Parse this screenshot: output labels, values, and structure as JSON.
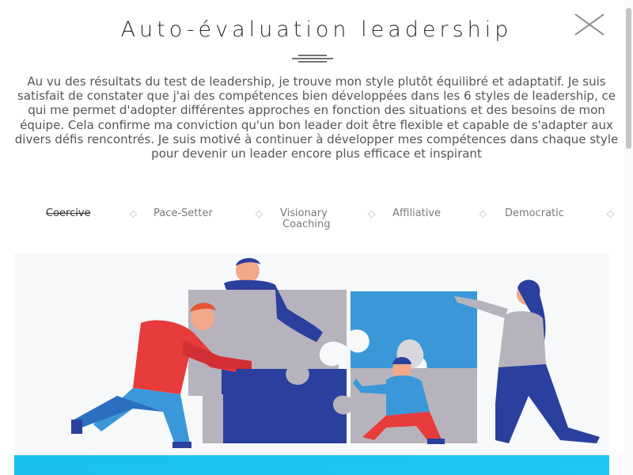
{
  "modal": {
    "title": "Auto-évaluation leadership",
    "close_icon": "close-icon",
    "intro_text": "Au vu des résultats du test de leadership, je trouve mon style plutôt équilibré et adaptatif. Je suis satisfait de constater que j'ai des compétences bien développées dans les 6 styles de leadership, ce qui me permet d'adopter différentes approches en fonction des situations et des besoins de mon équipe. Cela confirme ma conviction qu'un bon leader doit être flexible et capable de s'adapter aux divers défis rencontrés. Je suis motivé à continuer à développer mes compétences dans chaque style pour devenir un leader encore plus efficace et inspirant"
  },
  "tabs": [
    {
      "label": "Coercive",
      "active": true
    },
    {
      "label": "Pace-Setter",
      "active": false
    },
    {
      "label": "Visionary",
      "active": false
    },
    {
      "label": "Affiliative",
      "active": false
    },
    {
      "label": "Democratic",
      "active": false
    },
    {
      "label": "Coaching",
      "active": false
    }
  ],
  "illustration": {
    "name": "team-puzzle-illustration",
    "colors": {
      "red": "#e83b3b",
      "blue": "#2b3f9e",
      "light_blue": "#3b98d8",
      "gray": "#b7b3bc",
      "skin": "#f3a88a"
    }
  },
  "bottom_bar": {
    "color": "#19c2ee"
  }
}
